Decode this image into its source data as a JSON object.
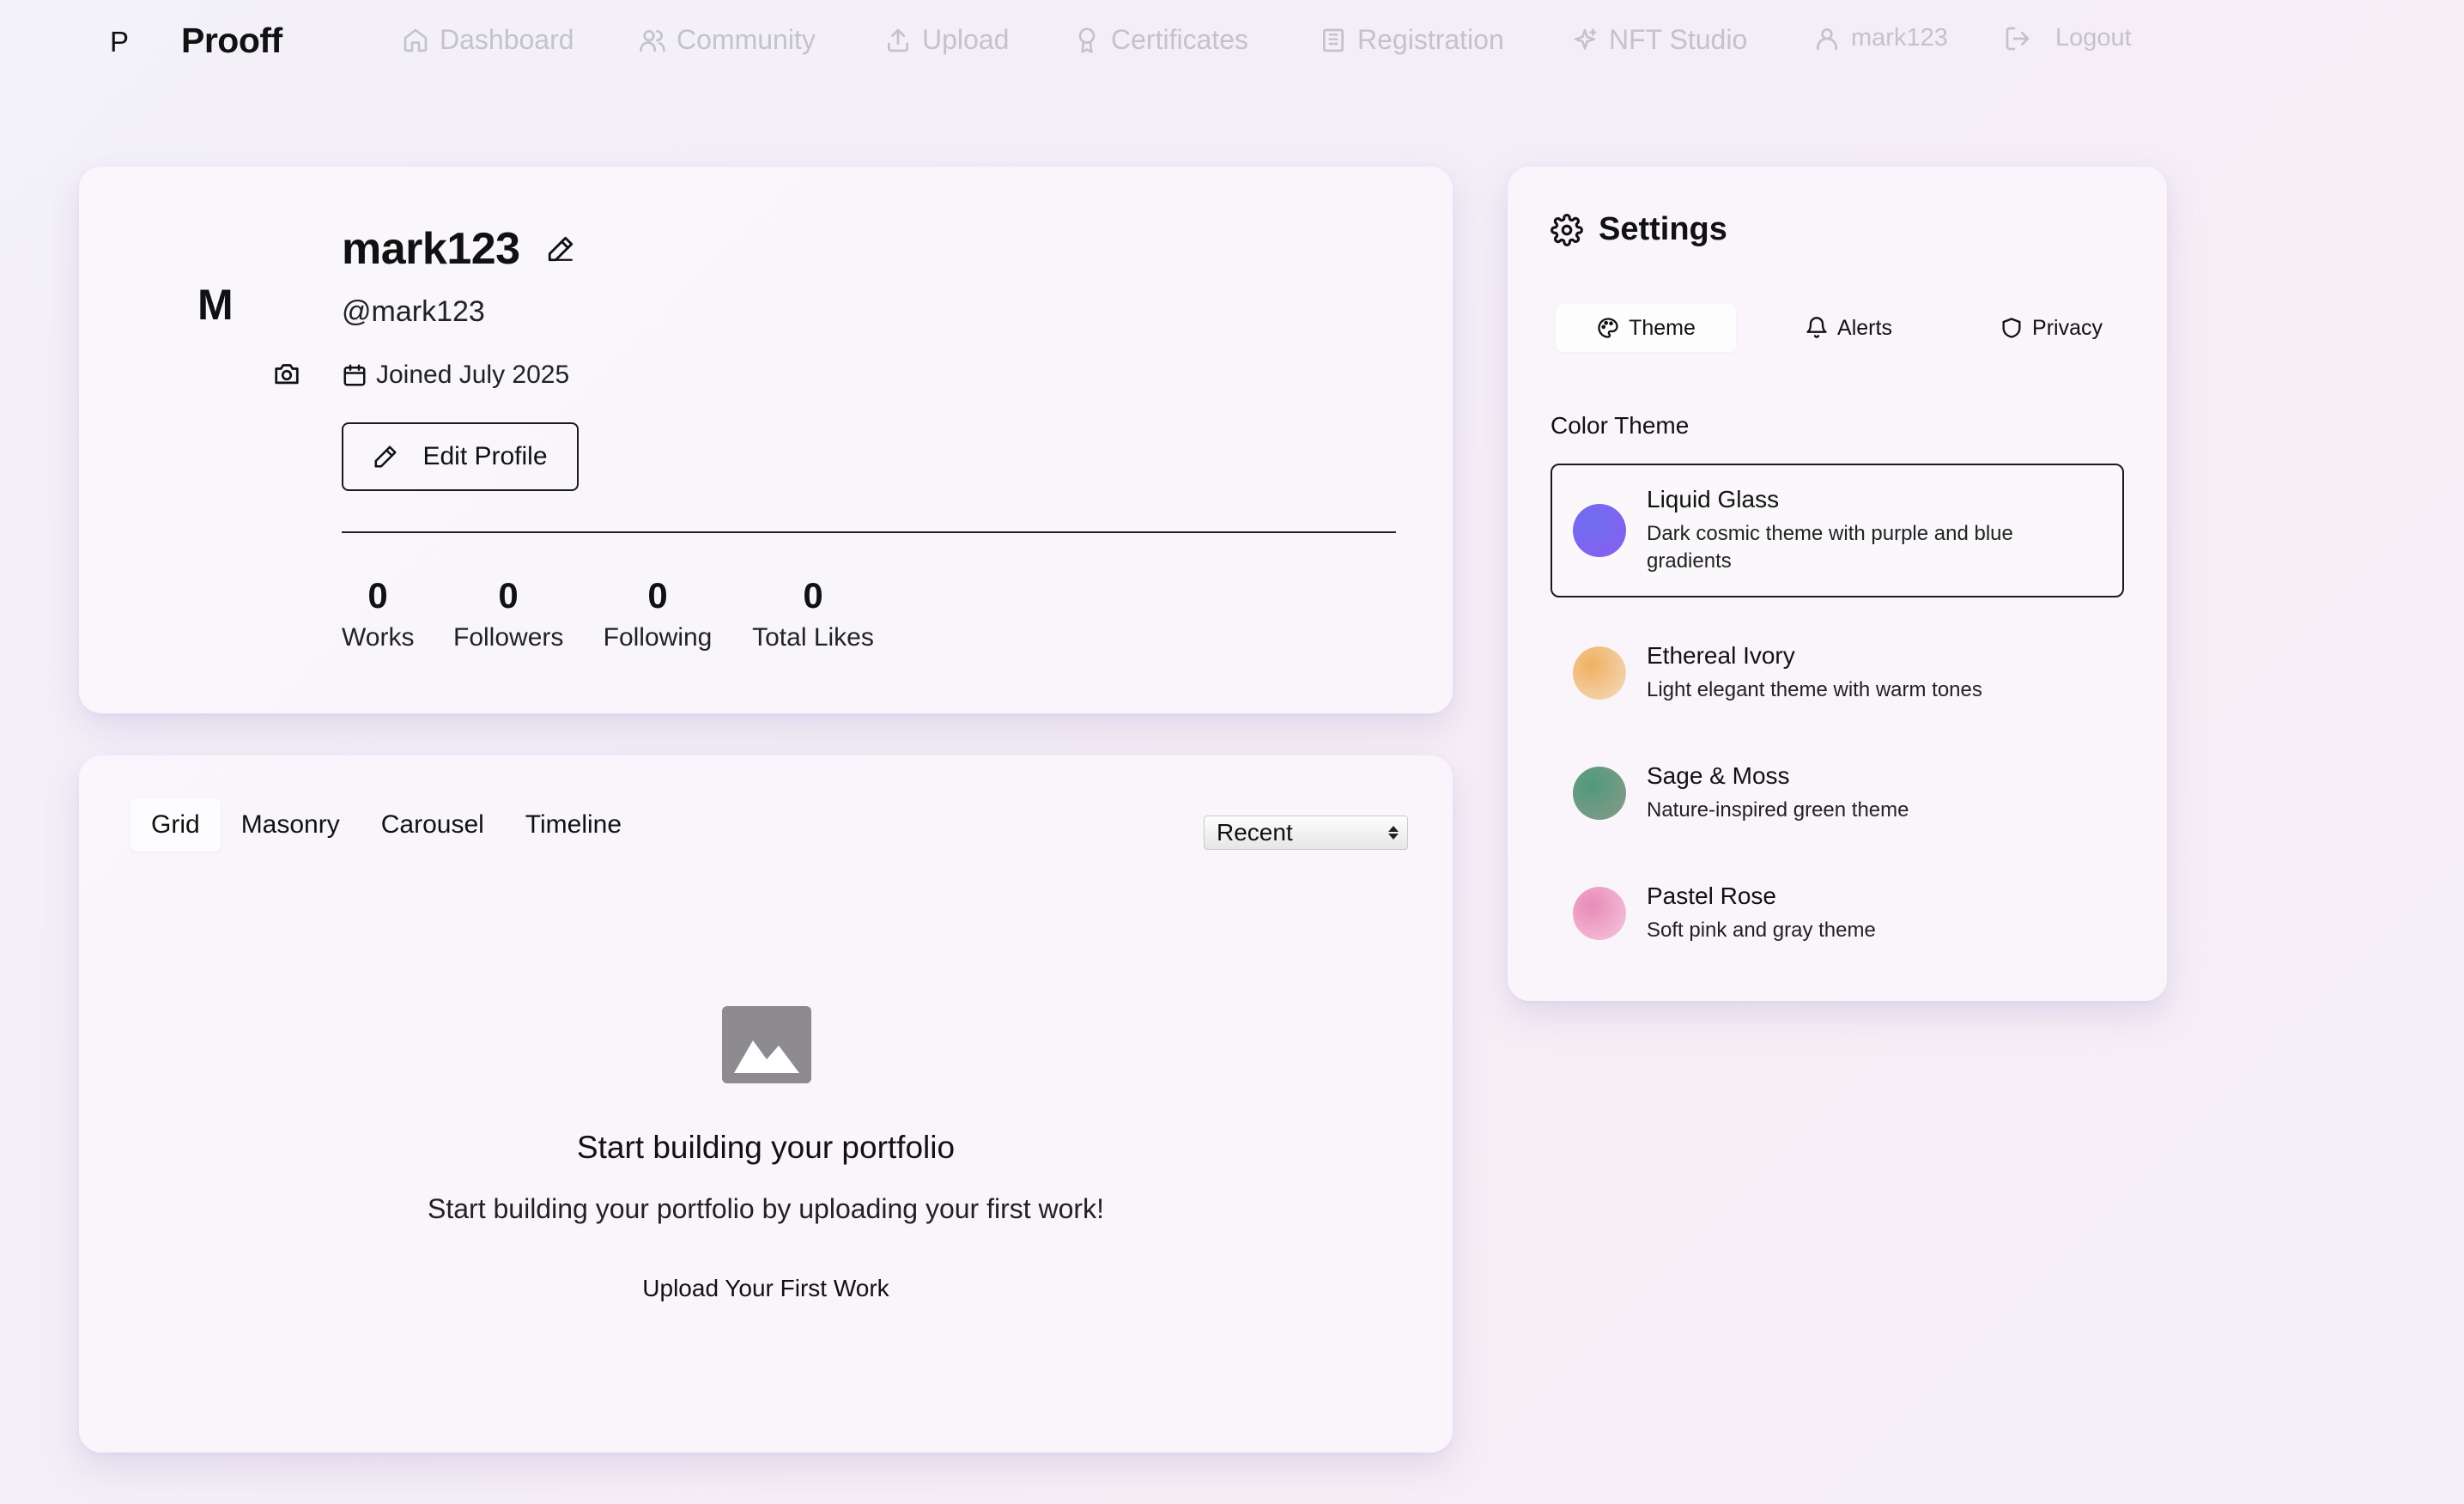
{
  "brand": {
    "mark": "P",
    "name": "Prooff"
  },
  "nav": {
    "items": [
      {
        "label": "Dashboard",
        "icon": "home-icon"
      },
      {
        "label": "Community",
        "icon": "users-icon"
      },
      {
        "label": "Upload",
        "icon": "upload-icon"
      },
      {
        "label": "Certificates",
        "icon": "award-icon"
      },
      {
        "label": "Registration",
        "icon": "building-icon"
      },
      {
        "label": "NFT Studio",
        "icon": "sparkles-icon"
      },
      {
        "label": "mark123",
        "icon": "user-icon"
      },
      {
        "label": "Logout",
        "icon": "logout-icon"
      }
    ]
  },
  "profile": {
    "avatar_letter": "M",
    "name": "mark123",
    "handle": "@mark123",
    "joined": "Joined July 2025",
    "edit_label": "Edit Profile",
    "stats": [
      {
        "value": "0",
        "label": "Works"
      },
      {
        "value": "0",
        "label": "Followers"
      },
      {
        "value": "0",
        "label": "Following"
      },
      {
        "value": "0",
        "label": "Total Likes"
      }
    ]
  },
  "gallery": {
    "tabs": [
      "Grid",
      "Masonry",
      "Carousel",
      "Timeline"
    ],
    "active_tab": "Grid",
    "sort_selected": "Recent",
    "empty_title": "Start building your portfolio",
    "empty_subtitle": "Start building your portfolio by uploading your first work!",
    "upload_cta": "Upload Your First Work"
  },
  "settings": {
    "title": "Settings",
    "tabs": [
      {
        "label": "Theme",
        "icon": "palette-icon"
      },
      {
        "label": "Alerts",
        "icon": "bell-icon"
      },
      {
        "label": "Privacy",
        "icon": "shield-icon"
      }
    ],
    "active_tab": "Theme",
    "section_label": "Color Theme",
    "themes": [
      {
        "name": "Liquid Glass",
        "description": "Dark cosmic theme with purple and blue gradients",
        "color_a": "#6f6ff0",
        "color_b": "#8a5cf0",
        "selected": true
      },
      {
        "name": "Ethereal Ivory",
        "description": "Light elegant theme with warm tones",
        "color_a": "#f0b060",
        "color_b": "#f5dcc0",
        "selected": false
      },
      {
        "name": "Sage & Moss",
        "description": "Nature-inspired green theme",
        "color_a": "#4f9a7a",
        "color_b": "#8a9a8a",
        "selected": false
      },
      {
        "name": "Pastel Rose",
        "description": "Soft pink and gray theme",
        "color_a": "#e88ab8",
        "color_b": "#f5c8dc",
        "selected": false
      }
    ]
  }
}
